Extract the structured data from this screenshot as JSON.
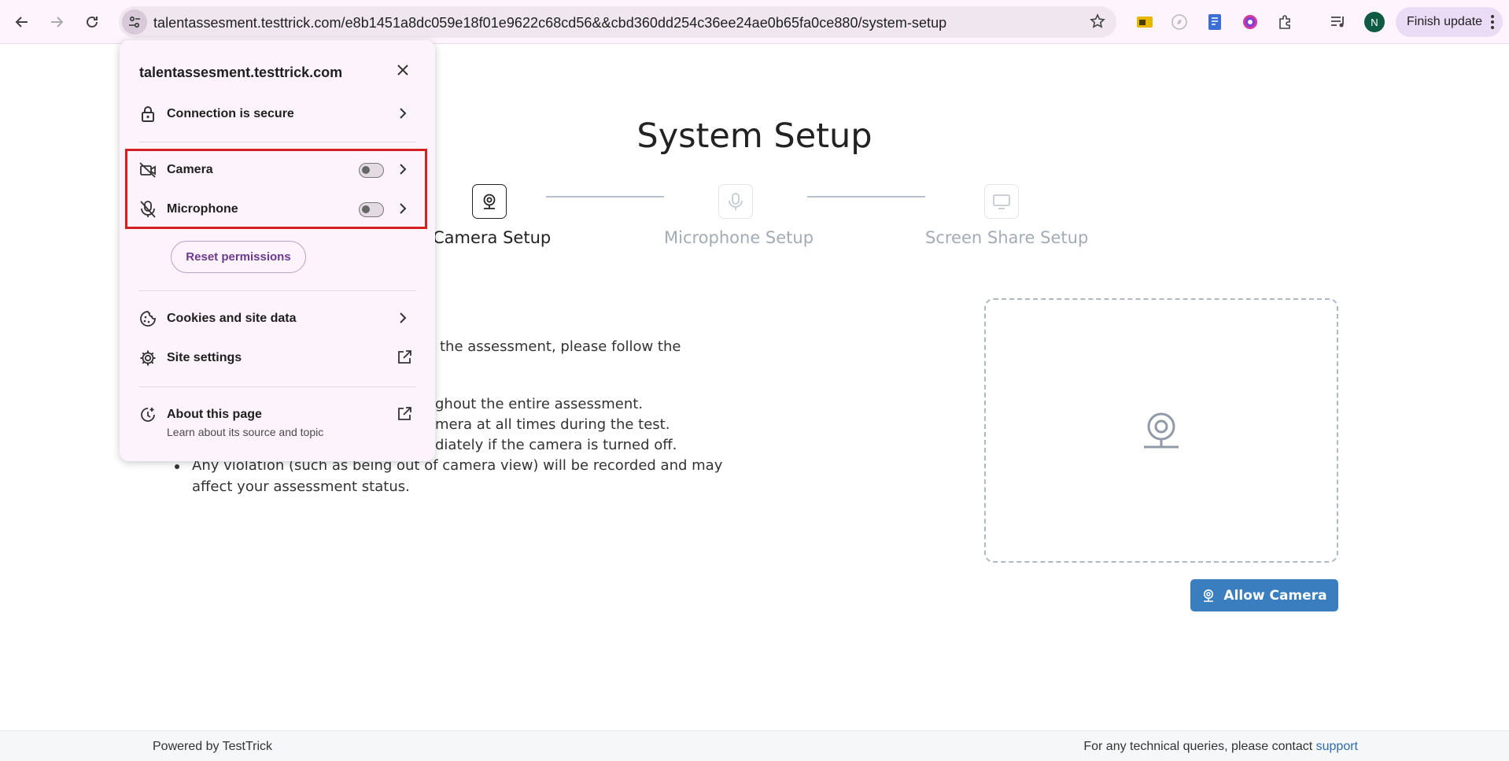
{
  "browser": {
    "url": "talentassesment.testtrick.com/e8b1451a8dc059e18f01e9622c68cd56&&cbd360dd254c36ee24ae0b65fa0ce880/system-setup",
    "avatar_initial": "N",
    "finish_update_label": "Finish update"
  },
  "page": {
    "title": "System Setup",
    "steps": [
      {
        "label": "Camera Setup",
        "state": "active"
      },
      {
        "label": "Microphone Setup",
        "state": "inactive"
      },
      {
        "label": "Screen Share Setup",
        "state": "inactive"
      }
    ],
    "intro_visible": "the assessment, please follow the",
    "rules_visible": [
      "ghout the entire assessment.",
      "mera at all times during the test.",
      "diately if the camera is turned off.",
      "Any violation (such as being out of camera view) will be recorded and may",
      "affect your assessment status."
    ],
    "allow_camera_label": "Allow Camera"
  },
  "footer": {
    "powered_by": "Powered by TestTrick",
    "contact_text": "For any technical queries, please contact",
    "support_link": "support"
  },
  "popup": {
    "domain": "talentassesment.testtrick.com",
    "connection_label": "Connection is secure",
    "camera_label": "Camera",
    "camera_enabled": false,
    "microphone_label": "Microphone",
    "microphone_enabled": false,
    "reset_label": "Reset permissions",
    "cookies_label": "Cookies and site data",
    "site_settings_label": "Site settings",
    "about_label": "About this page",
    "about_sub": "Learn about its source and topic"
  },
  "colors": {
    "accent_blue": "#3b7ec0",
    "highlight_red": "#d42020",
    "popup_bg": "#fcf3fc"
  }
}
